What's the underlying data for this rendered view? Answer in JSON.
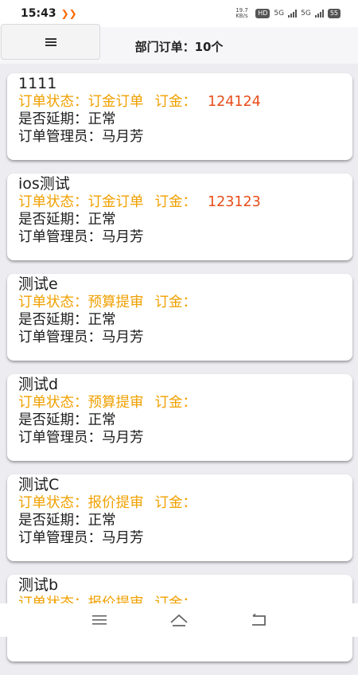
{
  "status_bar": {
    "time": "15:43",
    "net_speed": "19.7 KB/s",
    "hd_label": "HD",
    "sig1": "5G",
    "sig2": "5G",
    "battery": "55"
  },
  "header": {
    "title": "部门订单：10个"
  },
  "labels": {
    "status": "订单状态：",
    "amount": "订金：",
    "delay": "是否延期：",
    "manager": "订单管理员："
  },
  "orders": [
    {
      "title": "1111",
      "status": "订金订单",
      "amount": "124124",
      "delay": "正常",
      "manager": "马月芳"
    },
    {
      "title": "ios测试",
      "status": "订金订单",
      "amount": "123123",
      "delay": "正常",
      "manager": "马月芳"
    },
    {
      "title": "测试e",
      "status": "预算提审",
      "amount": "",
      "delay": "正常",
      "manager": "马月芳"
    },
    {
      "title": "测试d",
      "status": "预算提审",
      "amount": "",
      "delay": "正常",
      "manager": "马月芳"
    },
    {
      "title": "测试C",
      "status": "报价提审",
      "amount": "",
      "delay": "正常",
      "manager": "马月芳"
    },
    {
      "title": "测试b",
      "status": "报价提审",
      "amount": "",
      "delay": "",
      "manager": ""
    }
  ],
  "colors": {
    "status_text": "#f0a000",
    "amount_value": "#e84d1a"
  }
}
